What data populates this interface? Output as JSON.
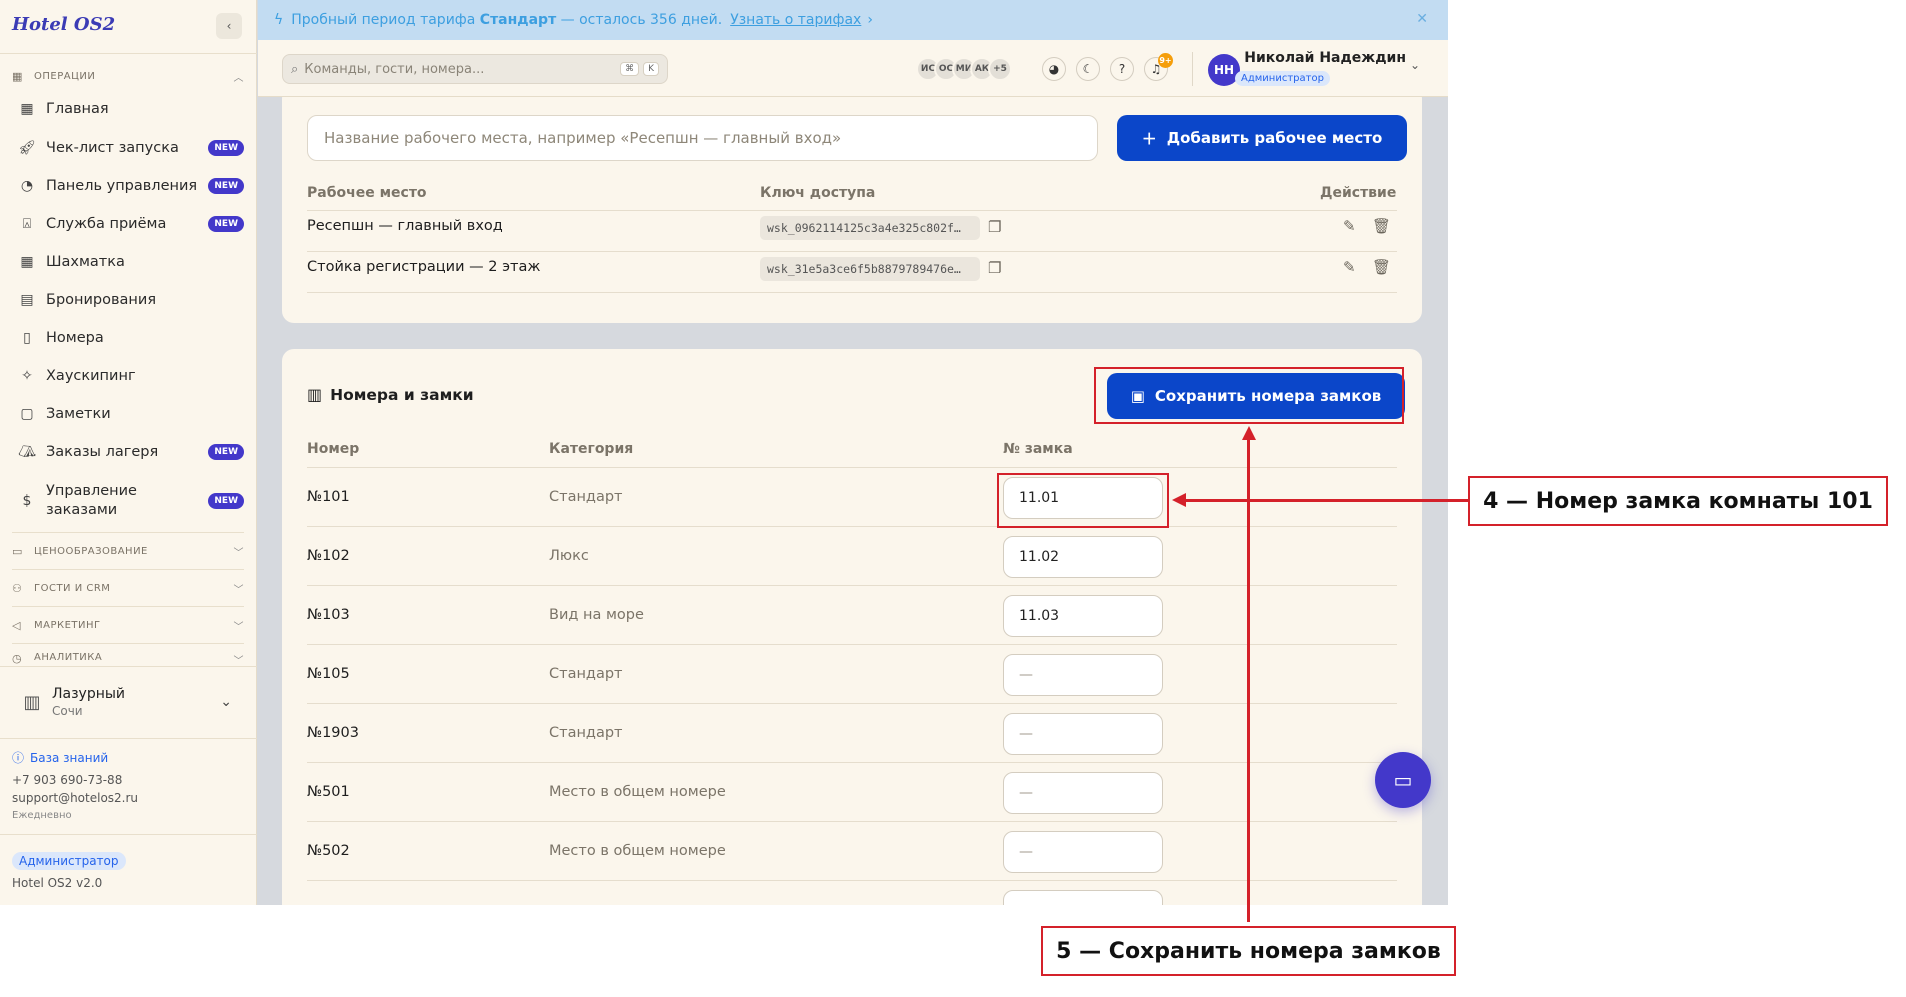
{
  "app": {
    "logo": "Hotel OS2",
    "collapse_icon": "chevron-left-icon"
  },
  "sidebar": {
    "sections": [
      {
        "key": "operations",
        "label": "ОПЕРАЦИИ",
        "expanded": true
      },
      {
        "key": "pricing",
        "label": "ЦЕНООБРАЗОВАНИЕ",
        "expanded": false
      },
      {
        "key": "guests",
        "label": "ГОСТИ И CRM",
        "expanded": false
      },
      {
        "key": "marketing",
        "label": "МАРКЕТИНГ",
        "expanded": false
      },
      {
        "key": "analytics",
        "label": "АНАЛИТИКА",
        "expanded": false
      }
    ],
    "items": [
      {
        "label": "Главная",
        "icon": "grid-icon",
        "badge": ""
      },
      {
        "label": "Чек-лист запуска",
        "icon": "rocket-icon",
        "badge": "NEW"
      },
      {
        "label": "Панель управления",
        "icon": "gauge-icon",
        "badge": "NEW"
      },
      {
        "label": "Служба приёма",
        "icon": "bell-icon",
        "badge": "NEW"
      },
      {
        "label": "Шахматка",
        "icon": "table-icon",
        "badge": ""
      },
      {
        "label": "Бронирования",
        "icon": "clipboard-icon",
        "badge": ""
      },
      {
        "label": "Номера",
        "icon": "door-icon",
        "badge": ""
      },
      {
        "label": "Хаускипинг",
        "icon": "sparkle-icon",
        "badge": ""
      },
      {
        "label": "Заметки",
        "icon": "note-icon",
        "badge": ""
      },
      {
        "label": "Заказы лагеря",
        "icon": "tent-icon",
        "badge": "NEW"
      },
      {
        "label": "Управление заказами",
        "icon": "dollar-icon",
        "badge": "NEW"
      }
    ],
    "hotel": {
      "name": "Лазурный",
      "city": "Сочи"
    },
    "footer": {
      "kb_label": "База знаний",
      "phone": "+7 903 690-73-88",
      "email": "support@hotelos2.ru",
      "schedule": "Ежедневно",
      "role": "Администратор",
      "version": "Hotel OS2 v2.0"
    }
  },
  "banner": {
    "prefix": "Пробный период тарифа",
    "plan": "Стандарт",
    "suffix": "— осталось 356 дней.",
    "link": "Узнать о тарифах",
    "link_chevron": "›",
    "close": "✕"
  },
  "topbar": {
    "search_placeholder": "Команды, гости, номера...",
    "shortcut_keys": [
      "⌘",
      "K"
    ],
    "online_users": [
      "ИС",
      "ОС",
      "МИ",
      "АК"
    ],
    "more_users": "+5",
    "notifications": "9+",
    "user": {
      "initials": "НН",
      "name": "Николай Надеждин",
      "role": "Администратор"
    }
  },
  "workplaces": {
    "input_placeholder": "Название рабочего места, например «Ресепшн — главный вход»",
    "add_button": "Добавить рабочее место",
    "columns": {
      "place": "Рабочее место",
      "key": "Ключ доступа",
      "action": "Действие"
    },
    "rows": [
      {
        "name": "Ресепшн — главный вход",
        "key": "wsk_0962114125c3a4e325c802f…"
      },
      {
        "name": "Стойка регистрации — 2 этаж",
        "key": "wsk_31e5a3ce6f5b8879789476e…"
      }
    ]
  },
  "locks": {
    "title": "Номера и замки",
    "save_button": "Сохранить номера замков",
    "columns": {
      "room": "Номер",
      "category": "Категория",
      "lock": "№ замка"
    },
    "placeholder": "—",
    "rows": [
      {
        "room": "№101",
        "category": "Стандарт",
        "lock": "11.01"
      },
      {
        "room": "№102",
        "category": "Люкс",
        "lock": "11.02"
      },
      {
        "room": "№103",
        "category": "Вид на море",
        "lock": "11.03"
      },
      {
        "room": "№105",
        "category": "Стандарт",
        "lock": ""
      },
      {
        "room": "№1903",
        "category": "Стандарт",
        "lock": ""
      },
      {
        "room": "№501",
        "category": "Место в общем номере",
        "lock": ""
      },
      {
        "room": "№502",
        "category": "Место в общем номере",
        "lock": ""
      }
    ]
  },
  "annotations": {
    "a4": "4 — Номер замка комнаты 101",
    "a5": "5 — Сохранить номера замков",
    "color": "#d4212a"
  },
  "colors": {
    "primary": "#0b46c9",
    "accent": "#4338ca",
    "banner_bg": "#c2dcf2",
    "surface": "#fbf6ec"
  }
}
